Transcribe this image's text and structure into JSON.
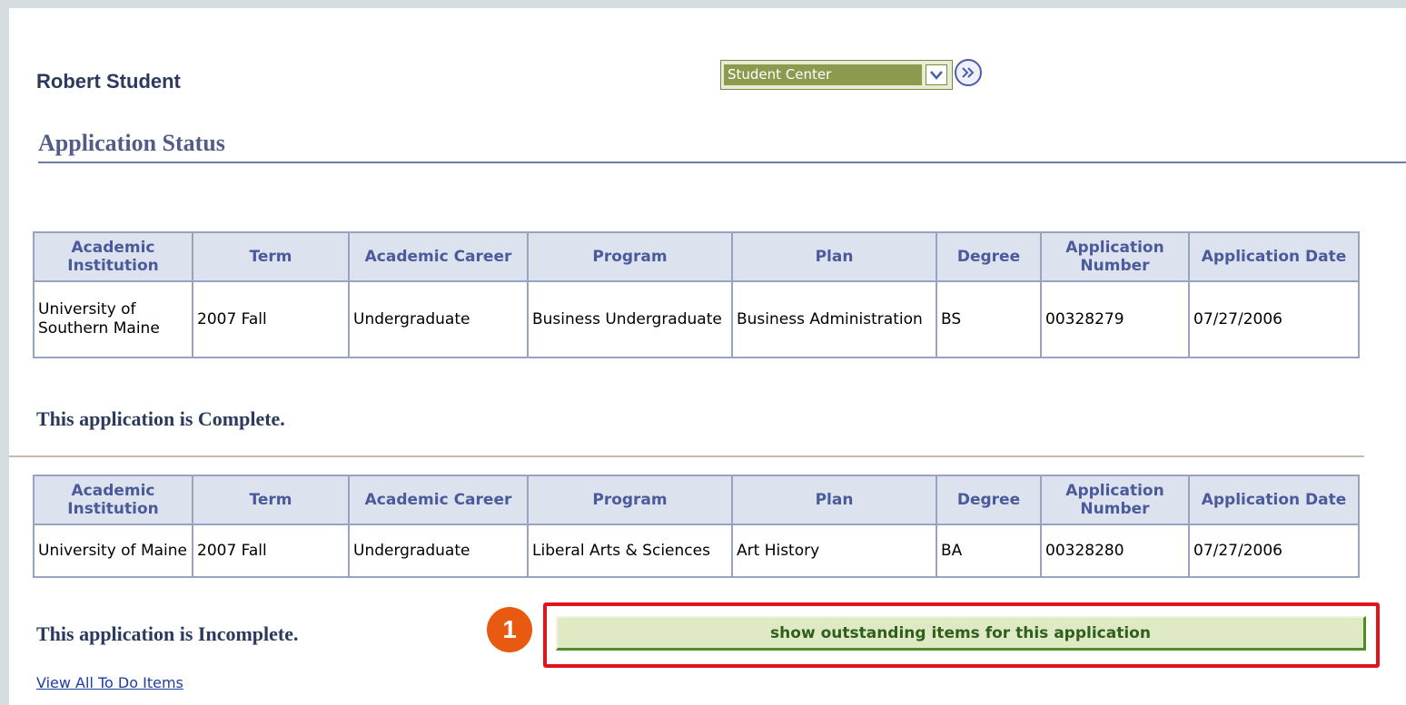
{
  "header": {
    "student_name": "Robert Student",
    "nav_select_value": "Student Center",
    "page_title": "Application Status"
  },
  "table_headers": [
    "Academic Institution",
    "Term",
    "Academic Career",
    "Program",
    "Plan",
    "Degree",
    "Application Number",
    "Application Date"
  ],
  "applications": [
    {
      "institution": "University of Southern Maine",
      "term": "2007 Fall",
      "career": "Undergraduate",
      "program": "Business Undergraduate",
      "plan": "Business Administration",
      "degree": "BS",
      "app_number": "00328279",
      "app_date": "07/27/2006",
      "status": "This application is Complete."
    },
    {
      "institution": "University of Maine",
      "term": "2007 Fall",
      "career": "Undergraduate",
      "program": "Liberal Arts & Sciences",
      "plan": "Art History",
      "degree": "BA",
      "app_number": "00328280",
      "app_date": "07/27/2006",
      "status": "This application is Incomplete."
    }
  ],
  "actions": {
    "outstanding_button": "show outstanding items for this application",
    "callout_number": "1",
    "todo_link": "View All To Do Items"
  },
  "colors": {
    "callout_border": "#e0141c",
    "callout_badge": "#e85a10",
    "button_bg": "#dfe9c3",
    "header_text": "#4b5a9a"
  }
}
